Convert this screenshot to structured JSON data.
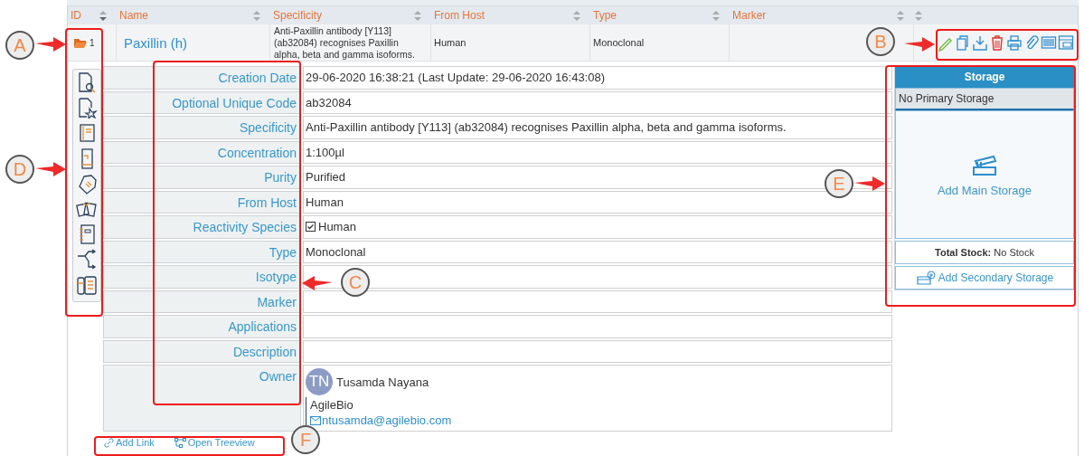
{
  "table": {
    "columns": [
      {
        "label": "ID"
      },
      {
        "label": "Name"
      },
      {
        "label": "Specificity"
      },
      {
        "label": "From Host"
      },
      {
        "label": "Type"
      },
      {
        "label": "Marker"
      }
    ],
    "row": {
      "id": "1",
      "name": "Paxillin (h)",
      "specificity": "Anti-Paxillin antibody [Y113] (ab32084) recognises Paxillin alpha, beta and gamma isoforms.",
      "from_host": "Human",
      "type": "Monoclonal"
    }
  },
  "details": [
    {
      "label": "Creation Date",
      "kind": "text",
      "value": "29-06-2020 16:38:21 (Last Update: 29-06-2020 16:43:08)"
    },
    {
      "label": "Optional Unique Code",
      "kind": "text",
      "value": "ab32084"
    },
    {
      "label": "Specificity",
      "kind": "text",
      "value": "Anti-Paxillin antibody [Y113] (ab32084) recognises Paxillin alpha, beta and gamma isoforms."
    },
    {
      "label": "Concentration",
      "kind": "text",
      "value": "1:100µl"
    },
    {
      "label": "Purity",
      "kind": "text",
      "value": "Purified"
    },
    {
      "label": "From Host",
      "kind": "text",
      "value": "Human"
    },
    {
      "label": "Reactivity Species",
      "kind": "check",
      "value": "Human",
      "checked": true
    },
    {
      "label": "Type",
      "kind": "text",
      "value": "Monoclonal"
    },
    {
      "label": "Isotype",
      "kind": "text"
    },
    {
      "label": "Marker",
      "kind": "text"
    },
    {
      "label": "Applications",
      "kind": "text"
    },
    {
      "label": "Description",
      "kind": "text"
    },
    {
      "label": "Owner",
      "kind": "owner",
      "initials": "TN",
      "name": "Tusamda Nayana",
      "organization": "AgileBio",
      "email": "ntusamda@agilebio.com"
    }
  ],
  "storage": {
    "title": "Storage",
    "primary": "No Primary Storage",
    "add_main": "Add Main Storage",
    "total_label": "Total Stock:",
    "total_value": "No Stock",
    "add_secondary": "Add Secondary Storage"
  },
  "links": [
    {
      "label": "Add Link",
      "kind": "link"
    },
    {
      "label": "Open Treeview",
      "kind": "tree"
    }
  ],
  "callouts": [
    {
      "letter": "A"
    },
    {
      "letter": "B"
    },
    {
      "letter": "C"
    },
    {
      "letter": "D"
    },
    {
      "letter": "E"
    },
    {
      "letter": "F"
    }
  ]
}
